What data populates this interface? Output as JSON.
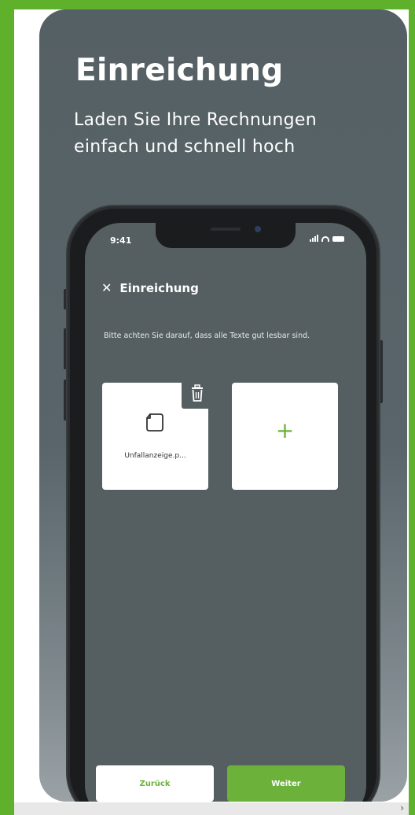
{
  "promo": {
    "headline": "Einreichung",
    "subline": "Laden Sie Ihre Rechnungen einfach und schnell hoch"
  },
  "status_bar": {
    "time": "9:41"
  },
  "nav": {
    "close_glyph": "✕",
    "title": "Einreichung"
  },
  "hint": "Bitte achten Sie darauf, dass alle Texte gut lesbar sind.",
  "uploads": [
    {
      "file_name": "Unfallanzeige.p...",
      "icon": "document-icon"
    }
  ],
  "add_tile": {
    "glyph": "+"
  },
  "buttons": {
    "back": "Zurück",
    "next": "Weiter"
  },
  "colors": {
    "accent": "#6bb13a",
    "frame_green": "#5fb02b",
    "screen_bg": "#555f62"
  }
}
